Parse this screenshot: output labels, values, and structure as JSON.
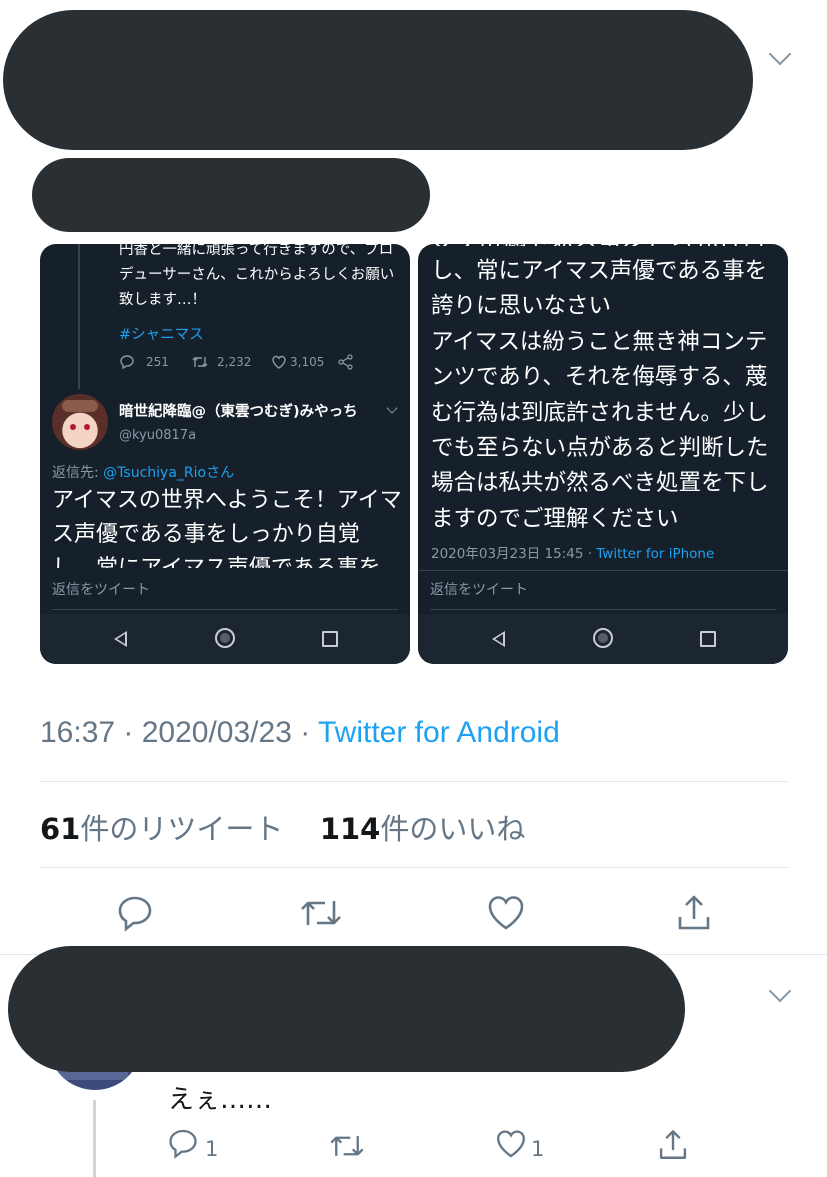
{
  "screenshot_left": {
    "prev_tweet_text": "円香と一緒に頑張って行きますので、プロデューサーさん、これからよろしくお願い致します…！",
    "hashtag": "#シャニマス",
    "stats": {
      "replies": "251",
      "retweets": "2,232",
      "likes": "3,105"
    },
    "reply_author": {
      "name": "暗世紀降臨@（東雲つむぎ)みやっち",
      "handle": "@kyu0817a"
    },
    "reply_to_prefix": "返信先: ",
    "reply_to_handle": "@Tsuchiya_Rioさん",
    "reply_text": "アイマスの世界へようこそ！アイマス声優である事をしっかり自覚し、常にアイマス声優である事を",
    "reply_placeholder": "返信をツイート"
  },
  "screenshot_right": {
    "body_text": "し、常にアイマス声優である事を誇りに思いなさい\nアイマスは紛うこと無き神コンテンツであり、それを侮辱する、蔑む行為は到底許されません。少しでも至らない点があると判断した場合は私共が然るべき処置を下しますのでご理解ください",
    "timestamp": "2020年03月23日 15:45 · ",
    "source": "Twitter for iPhone",
    "reply_placeholder": "返信をツイート"
  },
  "tweet_meta": {
    "time": "16:37 · 2020/03/23 · ",
    "source": "Twitter for Android"
  },
  "stats": {
    "retweet_count": "61",
    "retweet_label": "件のリツイート",
    "like_count": "114",
    "like_label": "件のいいね"
  },
  "reply_tweet": {
    "text": "えぇ……",
    "reply_count": "1",
    "like_count": "1"
  },
  "colors": {
    "accent": "#1da1f2",
    "muted": "#657786",
    "dark_bg": "#15202b",
    "redaction": "#2a2f34"
  }
}
